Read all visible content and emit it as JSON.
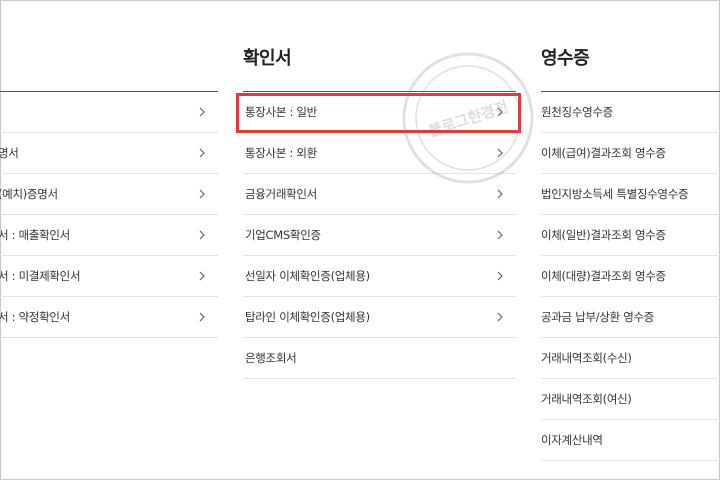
{
  "columns": [
    {
      "title": "",
      "items": [
        {
          "label": ""
        },
        {
          "label": "명서"
        },
        {
          "label": "(예치)증명서"
        },
        {
          "label": "서 : 매출확인서"
        },
        {
          "label": "서 : 미결제확인서"
        },
        {
          "label": "서 : 약정확인서"
        }
      ]
    },
    {
      "title": "확인서",
      "items": [
        {
          "label": "통장사본 : 일반"
        },
        {
          "label": "통장사본 : 외환"
        },
        {
          "label": "금융거래확인서"
        },
        {
          "label": "기업CMS확인증"
        },
        {
          "label": "선일자 이체확인증(업체용)"
        },
        {
          "label": "탑라인 이체확인증(업체용)"
        },
        {
          "label": "은행조회서"
        }
      ]
    },
    {
      "title": "영수증",
      "items": [
        {
          "label": "원천징수영수증"
        },
        {
          "label": "이체(급여)결과조회 영수증"
        },
        {
          "label": "법인지방소득세 특별징수영수증"
        },
        {
          "label": "이체(일반)결과조회 영수증"
        },
        {
          "label": "이체(대량)결과조회 영수증"
        },
        {
          "label": "공과금 납부/상환 영수증"
        },
        {
          "label": "거래내역조회(수신)"
        },
        {
          "label": "거래내역조회(여신)"
        },
        {
          "label": "이자계산내역"
        }
      ]
    }
  ],
  "icons": {
    "chevron": "chevron-right-icon"
  },
  "colors": {
    "highlight": "#e03c3c",
    "rule": "#555555",
    "divider": "#e2e2e2"
  },
  "watermark": {
    "text": "블로그한경전"
  }
}
